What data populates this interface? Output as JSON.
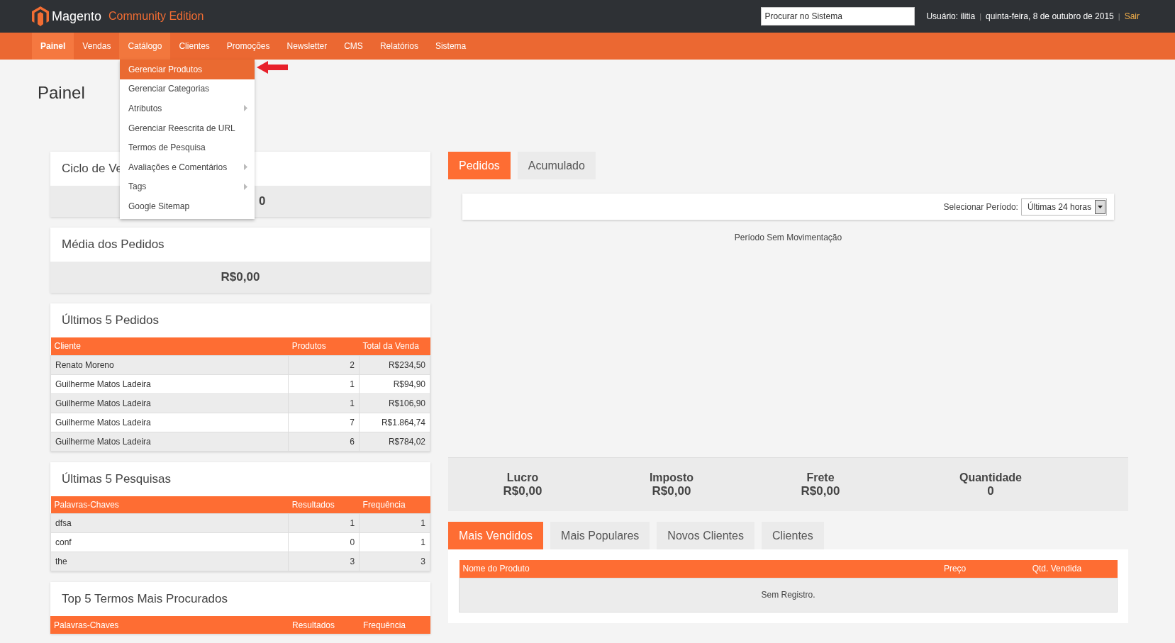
{
  "header": {
    "logo_text": "Magento",
    "edition": "Community Edition",
    "search": {
      "placeholder": "Procurar no Sistema"
    },
    "user": "Usuário: ilitia",
    "separators": [
      "|",
      "|"
    ],
    "date": "quinta-feira, 8 de outubro de 2015",
    "logout": "Sair"
  },
  "nav": [
    {
      "label": "Painel",
      "selected": true,
      "expanded": false
    },
    {
      "label": "Vendas",
      "selected": false,
      "expanded": false
    },
    {
      "label": "Catálogo",
      "selected": false,
      "expanded": true
    },
    {
      "label": "Clientes",
      "selected": false,
      "expanded": false
    },
    {
      "label": "Promoções",
      "selected": false,
      "expanded": false
    },
    {
      "label": "Newsletter",
      "selected": false,
      "expanded": false
    },
    {
      "label": "CMS",
      "selected": false,
      "expanded": false
    },
    {
      "label": "Relatórios",
      "selected": false,
      "expanded": false
    },
    {
      "label": "Sistema",
      "selected": false,
      "expanded": false
    }
  ],
  "menu": [
    {
      "label": "Gerenciar Produtos",
      "selected": true,
      "submenu": false
    },
    {
      "label": "Gerenciar Categorias",
      "selected": false,
      "submenu": false
    },
    {
      "label": "Atributos",
      "selected": false,
      "submenu": true
    },
    {
      "label": "Gerenciar Reescrita de URL",
      "selected": false,
      "submenu": false
    },
    {
      "label": "Termos de Pesquisa",
      "selected": false,
      "submenu": false
    },
    {
      "label": "Avaliações e Comentários",
      "selected": false,
      "submenu": true
    },
    {
      "label": "Tags",
      "selected": false,
      "submenu": true
    },
    {
      "label": "Google Sitemap",
      "selected": false,
      "submenu": false
    }
  ],
  "page_title": "Painel",
  "stat_cards": [
    {
      "title": "Ciclo de Ve",
      "value": "0",
      "covered": true
    },
    {
      "title": "Média dos Pedidos",
      "value": "R$0,00",
      "covered": false
    }
  ],
  "tables": [
    {
      "title": "Últimos 5 Pedidos",
      "columns": [
        "Cliente",
        "Produtos",
        "Total da Venda"
      ],
      "rows": [
        [
          "Renato Moreno",
          "2",
          "R$234,50"
        ],
        [
          "Guilherme Matos Ladeira",
          "1",
          "R$94,90"
        ],
        [
          "Guilherme Matos Ladeira",
          "1",
          "R$106,90"
        ],
        [
          "Guilherme Matos Ladeira",
          "7",
          "R$1.864,74"
        ],
        [
          "Guilherme Matos Ladeira",
          "6",
          "R$784,02"
        ]
      ]
    },
    {
      "title": "Últimas 5 Pesquisas",
      "columns": [
        "Palavras-Chaves",
        "Resultados",
        "Frequência"
      ],
      "rows": [
        [
          "dfsa",
          "1",
          "1"
        ],
        [
          "conf",
          "0",
          "1"
        ],
        [
          "the",
          "3",
          "3"
        ]
      ]
    },
    {
      "title": "Top 5 Termos Mais Procurados",
      "columns": [
        "Palavras-Chaves",
        "Resultados",
        "Frequência"
      ]
    }
  ],
  "chart_tabs": [
    {
      "label": "Pedidos",
      "selected": true
    },
    {
      "label": "Acumulado",
      "selected": false
    }
  ],
  "period": {
    "label": "Selecionar Período:",
    "value": "Últimas 24 horas"
  },
  "chart_message": "Período Sem Movimentação",
  "totals": [
    {
      "label": "Lucro",
      "value": "R$0,00"
    },
    {
      "label": "Imposto",
      "value": "R$0,00"
    },
    {
      "label": "Frete",
      "value": "R$0,00"
    },
    {
      "label": "Quantidade",
      "value": "0"
    }
  ],
  "product_tabs": [
    {
      "label": "Mais Vendidos",
      "selected": true
    },
    {
      "label": "Mais Populares",
      "selected": false
    },
    {
      "label": "Novos Clientes",
      "selected": false
    },
    {
      "label": "Clientes",
      "selected": false
    }
  ],
  "product_table": {
    "columns": [
      "Nome do Produto",
      "Preço",
      "Qtd. Vendida"
    ],
    "empty": "Sem Registro."
  }
}
